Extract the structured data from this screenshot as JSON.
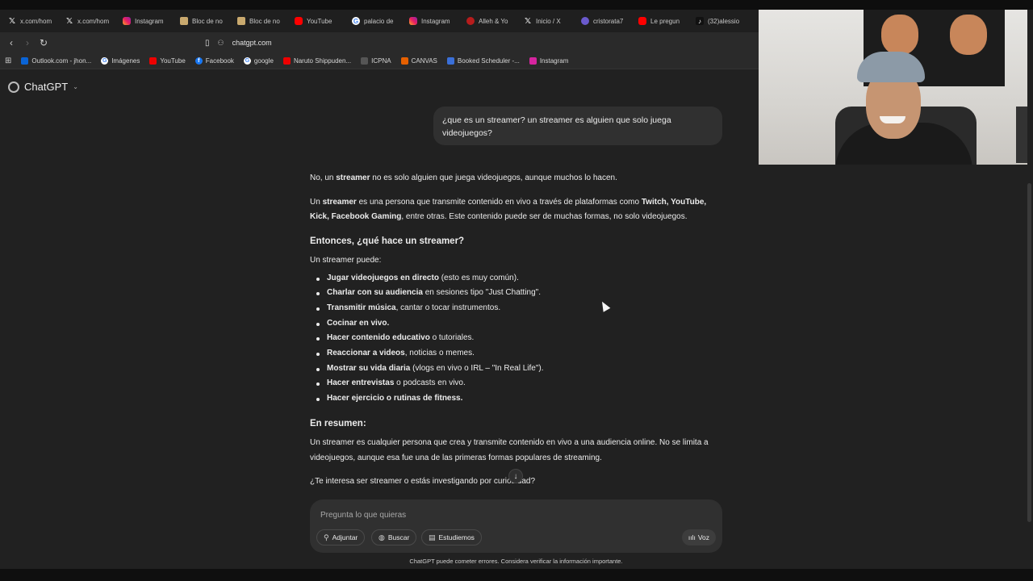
{
  "browser": {
    "tabs": [
      {
        "label": "x.com/hom",
        "icon": "x-icon"
      },
      {
        "label": "x.com/hom",
        "icon": "x-icon"
      },
      {
        "label": "Instagram",
        "icon": "instagram-icon"
      },
      {
        "label": "Bloc de no",
        "icon": "note-icon"
      },
      {
        "label": "Bloc de no",
        "icon": "note-icon"
      },
      {
        "label": "YouTube",
        "icon": "youtube-icon"
      },
      {
        "label": "palacio de",
        "icon": "google-icon"
      },
      {
        "label": "Instagram",
        "icon": "instagram-icon"
      },
      {
        "label": "Alleh & Yo",
        "icon": "brand-icon"
      },
      {
        "label": "Inicio / X",
        "icon": "x-icon"
      },
      {
        "label": "cristorata7",
        "icon": "circle-icon"
      },
      {
        "label": "Le pregun",
        "icon": "youtube-icon"
      },
      {
        "label": "(32)alessio",
        "icon": "tiktok-icon"
      }
    ],
    "url": "chatgpt.com",
    "bookmarks": [
      {
        "label": "Outlook.com - jhon...",
        "icon": "outlook-icon"
      },
      {
        "label": "Imágenes",
        "icon": "google-icon"
      },
      {
        "label": "YouTube",
        "icon": "youtube-icon"
      },
      {
        "label": "Facebook",
        "icon": "facebook-icon"
      },
      {
        "label": "google",
        "icon": "google-icon"
      },
      {
        "label": "Naruto Shippuden...",
        "icon": "youtube-icon"
      },
      {
        "label": "ICPNA",
        "icon": "icpna-icon"
      },
      {
        "label": "CANVAS",
        "icon": "canvas-icon"
      },
      {
        "label": "Booked Scheduler -...",
        "icon": "dot-icon"
      },
      {
        "label": "Instagram",
        "icon": "instagram-icon"
      }
    ]
  },
  "chat": {
    "app_name": "ChatGPT",
    "user_message": "¿que es un streamer? un streamer es alguien que solo juega videojuegos?",
    "answer": {
      "p1_pre": "No, un ",
      "p1_bold": "streamer",
      "p1_post": " no es solo alguien que juega videojuegos, aunque muchos lo hacen.",
      "p2_a": "Un ",
      "p2_b": "streamer",
      "p2_c": " es una persona que transmite contenido en vivo a través de plataformas como ",
      "p2_d": "Twitch, YouTube, Kick, Facebook Gaming",
      "p2_e": ", entre otras. Este contenido puede ser de muchas formas, no solo videojuegos.",
      "h1": "Entonces, ¿qué hace un streamer?",
      "intro": "Un streamer puede:",
      "items": [
        {
          "bold": "Jugar videojuegos en directo",
          "rest": " (esto es muy común)."
        },
        {
          "bold": "Charlar con su audiencia",
          "rest": " en sesiones tipo \"Just Chatting\"."
        },
        {
          "bold": "Transmitir música",
          "rest": ", cantar o tocar instrumentos."
        },
        {
          "bold": "Cocinar en vivo.",
          "rest": ""
        },
        {
          "bold": "Hacer contenido educativo",
          "rest": " o tutoriales."
        },
        {
          "bold": "Reaccionar a videos",
          "rest": ", noticias o memes."
        },
        {
          "bold": "Mostrar su vida diaria",
          "rest": " (vlogs en vivo o IRL – \"In Real Life\")."
        },
        {
          "bold": "Hacer entrevistas",
          "rest": " o podcasts en vivo."
        },
        {
          "bold": "Hacer ejercicio o rutinas de fitness.",
          "rest": ""
        }
      ],
      "h2": "En resumen:",
      "summary": "Un streamer es cualquier persona que crea y transmite contenido en vivo a una audiencia online. No se limita a videojuegos, aunque esa fue una de las primeras formas populares de streaming.",
      "question": "¿Te interesa ser streamer o estás investigando por curiosidad?"
    },
    "composer": {
      "placeholder": "Pregunta lo que quieras",
      "attach_label": "Adjuntar",
      "search_label": "Buscar",
      "study_label": "Estudiemos",
      "voice_label": "Voz"
    },
    "disclaimer": "ChatGPT puede cometer errores. Considera verificar la información importante."
  }
}
